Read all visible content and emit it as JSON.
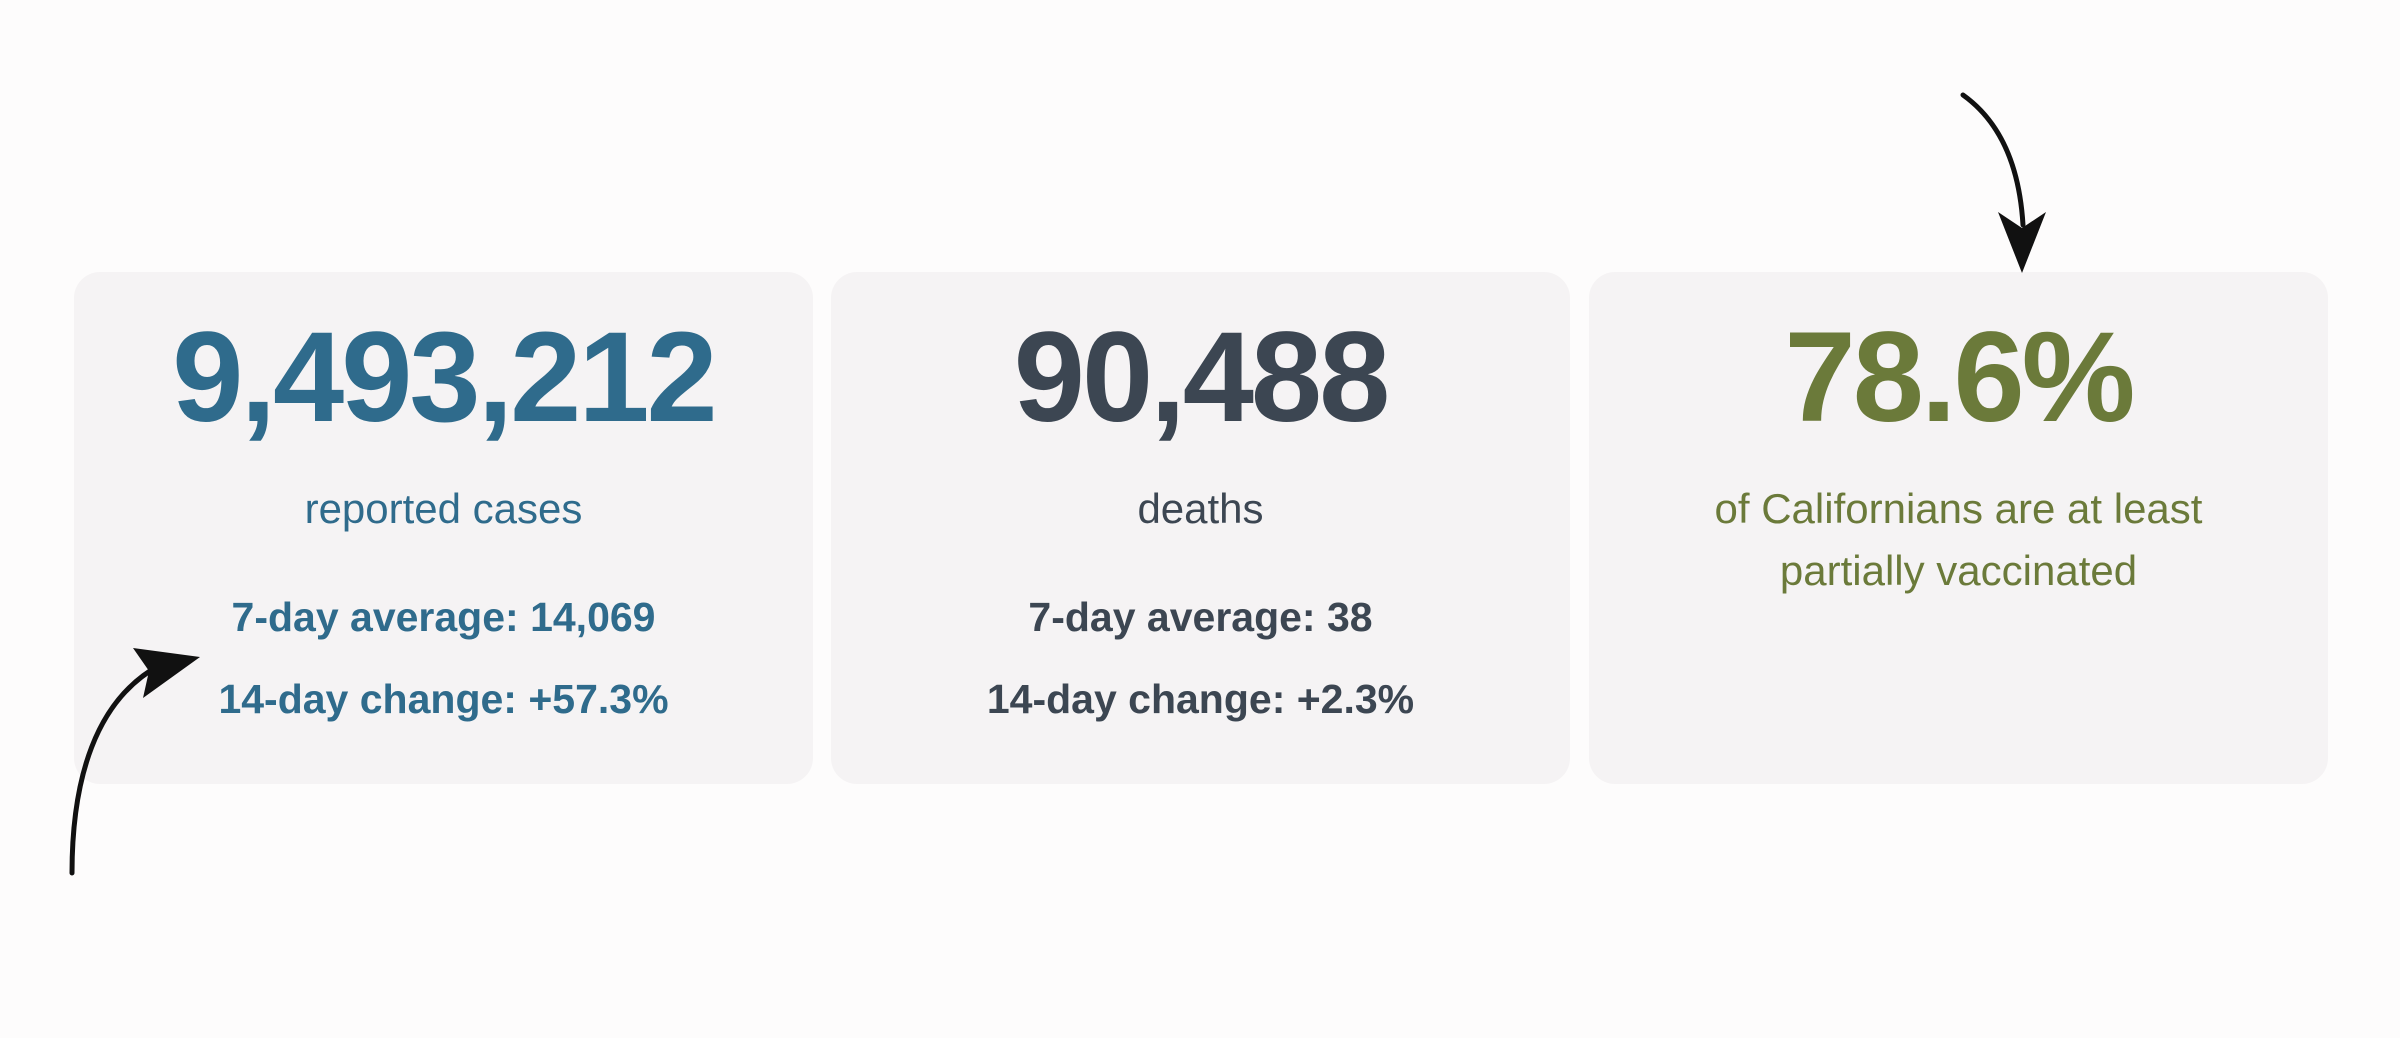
{
  "cards": {
    "cases": {
      "value": "9,493,212",
      "label": "reported cases",
      "avg": "7-day average: 14,069",
      "change": "14-day change: +57.3%"
    },
    "deaths": {
      "value": "90,488",
      "label": "deaths",
      "avg": "7-day average: 38",
      "change": "14-day change: +2.3%"
    },
    "vaccinated": {
      "value": "78.6%",
      "label": "of Californians are at least partially vaccinated"
    }
  },
  "colors": {
    "cases": "#2f6b8c",
    "deaths": "#3c4652",
    "vaccinated": "#6b7a3a",
    "card_background": "#f5f3f4",
    "arrow": "#111111"
  },
  "icons": [
    "curved-arrow-icon-pointing-to-7-day-average",
    "curved-arrow-icon-pointing-to-vaccinated-card"
  ]
}
